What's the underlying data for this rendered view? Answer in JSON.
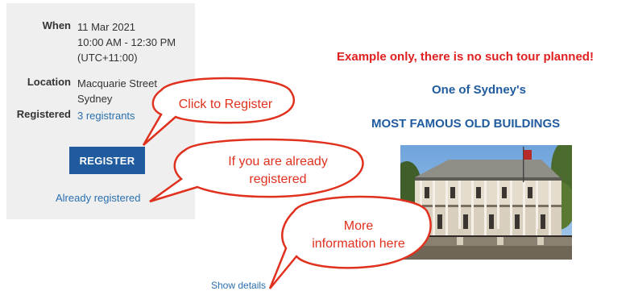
{
  "event": {
    "when_label": "When",
    "when_line1": "11 Mar 2021",
    "when_line2": "10:00 AM - 12:30 PM",
    "when_line3": "(UTC+11:00)",
    "location_label": "Location",
    "location_line1": "Macquarie Street",
    "location_line2": "Sydney",
    "registered_label": "Registered",
    "registrants_link": "3 registrants",
    "register_button": "REGISTER",
    "already_registered_link": "Already registered"
  },
  "content": {
    "notice": "Example only, there is no such tour planned!",
    "subtitle": "One of Sydney's",
    "heading": "MOST FAMOUS OLD BUILDINGS",
    "show_details_link": "Show details"
  },
  "callouts": {
    "click_to_register": "Click to Register",
    "already_line1": "If you are already",
    "already_line2": "registered",
    "more_line1": "More",
    "more_line2": "information here"
  },
  "colors": {
    "accent_blue": "#1f5b9e",
    "link_blue": "#2a6fb0",
    "notice_red": "#e02020",
    "callout_red": "#e0311e",
    "panel_bg": "#efefef"
  }
}
